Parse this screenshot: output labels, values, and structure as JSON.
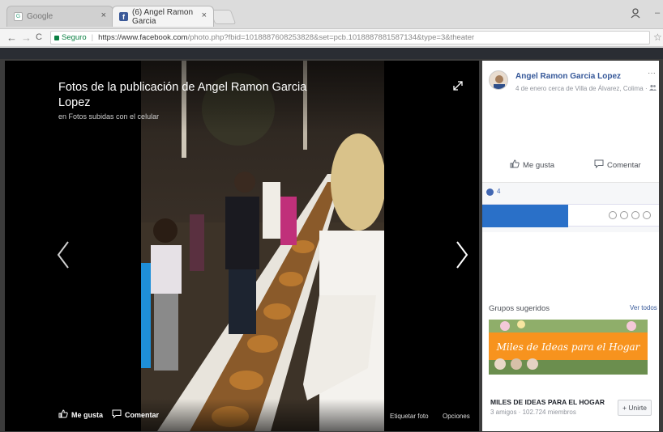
{
  "browser": {
    "tabs": [
      {
        "title": "Google",
        "favicon": "google-favicon-icon"
      },
      {
        "title": "(6) Angel Ramon Garcia",
        "favicon": "facebook-favicon-icon"
      }
    ],
    "close_glyph": "×",
    "nav": {
      "back": "←",
      "forward": "→",
      "reload": "C"
    },
    "address": {
      "secure_label": "Seguro",
      "url_host": "https://www.facebook.com",
      "url_rest": "/photo.php?fbid=1018887608253828&set=pcb.1018887881587134&type=3&theater"
    }
  },
  "theater": {
    "title": "Fotos de la publicación de Angel Ramon Garcia Lopez",
    "subtitle": "en Fotos subidas con el celular",
    "like_label": "Me gusta",
    "comment_label": "Comentar",
    "tag_photo_label": "Etiquetar foto",
    "options_label": "Opciones"
  },
  "panel": {
    "poster_name": "Angel Ramon Garcia Lopez",
    "poster_meta": "4 de enero cerca de Villa de Álvarez, Colima · ",
    "like_label": "Me gusta",
    "comment_label": "Comentar",
    "like_count": "4",
    "groups": {
      "title": "Grupos sugeridos",
      "see_all": "Ver todos",
      "group_name": "MILES DE IDEAS PARA EL HOGAR",
      "group_meta": "3 amigos · 102.724 miembros",
      "group_banner_text": "Miles de Ideas para el Hogar",
      "join_label": "+ Unirte"
    }
  },
  "colors": {
    "facebook_blue": "#3b5998",
    "link_blue": "#365899",
    "accent_blue": "#2a70c8",
    "secure_green": "#0b8043",
    "banner_orange": "#f7931e"
  }
}
